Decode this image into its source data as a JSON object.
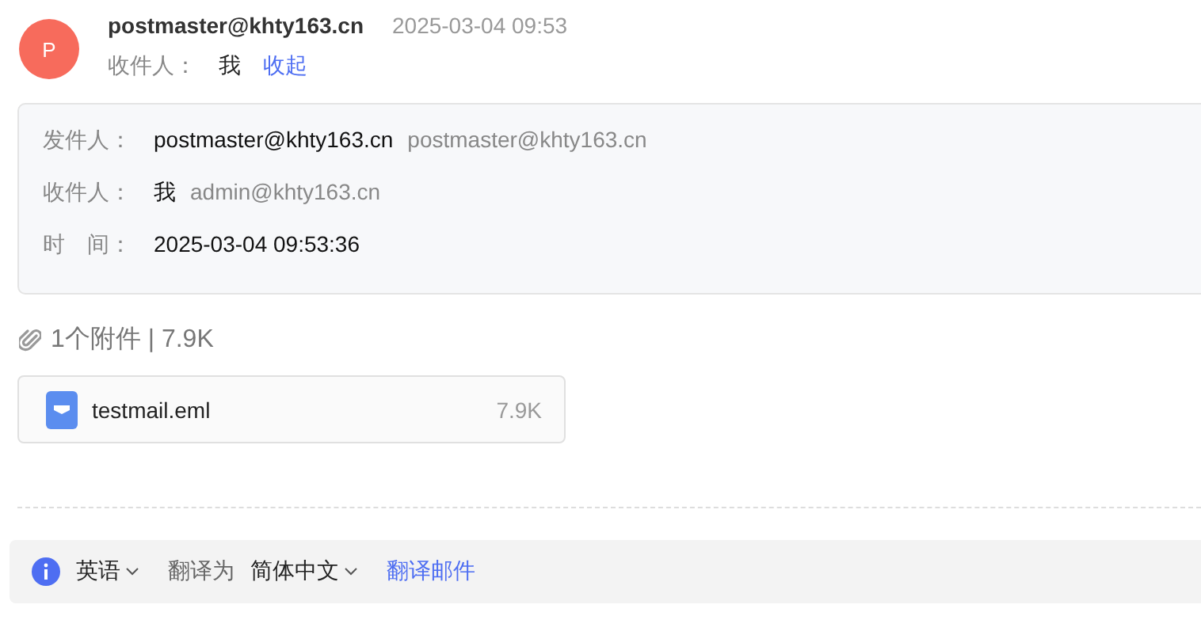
{
  "header": {
    "avatar": "P",
    "sender": "postmaster@khty163.cn",
    "time": "2025-03-04 09:53",
    "recipients_label": "收件人：",
    "recipient": "我",
    "collapse": "收起"
  },
  "details": [
    {
      "label": "发件人：",
      "name": "postmaster@khty163.cn",
      "address": "postmaster@khty163.cn"
    },
    {
      "label": "收件人：",
      "name": "我",
      "address": "admin@khty163.cn"
    },
    {
      "label": "时　间：",
      "name": "2025-03-04 09:53:36"
    }
  ],
  "attachments": {
    "summary": "1个附件 | 7.9K",
    "files": [
      {
        "name": "testmail.eml",
        "size": "7.9K"
      }
    ]
  },
  "translate": {
    "source": "英语",
    "label": "翻译为",
    "target": "简体中文",
    "action": "翻译邮件"
  }
}
